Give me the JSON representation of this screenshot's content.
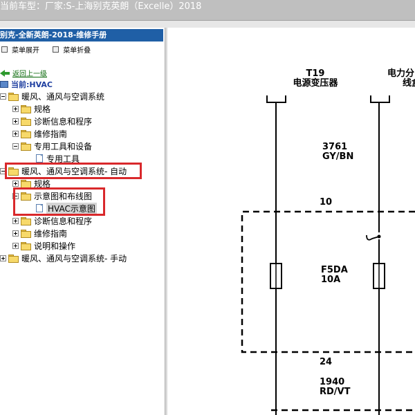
{
  "window": {
    "title": "当前车型：厂家:S-上海别克英朗（Excelle）2018"
  },
  "sidebar": {
    "book_title": "别克-全新英朗-2018-维修手册",
    "menu": {
      "expand_label": "菜单展开",
      "collapse_label": "菜单折叠"
    },
    "back_label": "返回上一级",
    "current_label": "当前:HVAC",
    "tree": [
      {
        "label": "暖风、通风与空调系统"
      },
      {
        "label": "规格"
      },
      {
        "label": "诊断信息和程序"
      },
      {
        "label": "维修指南"
      },
      {
        "label": "专用工具和设备"
      },
      {
        "label": "专用工具"
      },
      {
        "label": "暖风、通风与空调系统- 自动"
      },
      {
        "label": "规格"
      },
      {
        "label": "示意图和布线图"
      },
      {
        "label": "HVAC示意图"
      },
      {
        "label": "诊断信息和程序"
      },
      {
        "label": "维修指南"
      },
      {
        "label": "说明和操作"
      },
      {
        "label": "暖风、通风与空调系统- 手动"
      }
    ]
  },
  "diagram": {
    "connector_left_id": "T19",
    "connector_left_name": "电源变压器",
    "connector_right_line1": "电力分",
    "connector_right_line2": "线盒",
    "wire_top_code": "3761",
    "wire_top_color": "GY/BN",
    "pin_top": "10",
    "fuse_name": "F5DA",
    "fuse_rating": "10A",
    "pin_bottom": "24",
    "wire_bottom_code": "1940",
    "wire_bottom_color": "RD/VT"
  },
  "colors": {
    "titlebar_bg": "#bfbfbf",
    "book_title_bg": "#1f5fa6",
    "highlight_red": "#d9282b",
    "current_label": "#1f3fa0",
    "back_link": "#0b6a0b"
  }
}
